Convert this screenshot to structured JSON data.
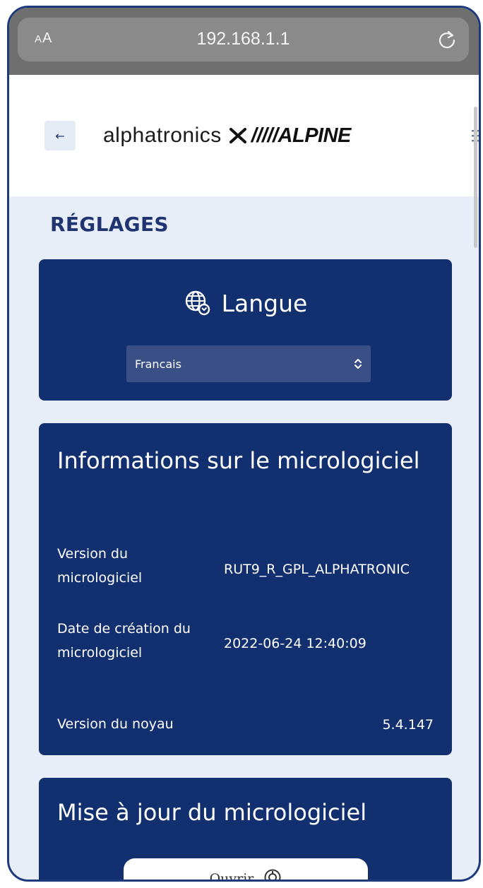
{
  "browser": {
    "text_size_label_small": "A",
    "text_size_label_large": "A",
    "url": "192.168.1.1"
  },
  "header": {
    "back_label": "←",
    "logo_brand_left": "alphatronics",
    "logo_separator": "×",
    "logo_brand_right": "/////ALPINE"
  },
  "page": {
    "title": "RÉGLAGES"
  },
  "language_card": {
    "title": "Langue",
    "selected_language": "Francais"
  },
  "firmware_info": {
    "title": "Informations sur le micrologiciel",
    "rows": [
      {
        "label": "Version du micrologiciel",
        "value": "RUT9_R_GPL_ALPHATRONIC"
      },
      {
        "label": "Date de création du micrologiciel",
        "value": "2022-06-24 12:40:09"
      },
      {
        "label": "Version du noyau",
        "value": "5.4.147"
      }
    ]
  },
  "firmware_update": {
    "title": "Mise à jour du micrologiciel",
    "open_button_label": "Ouvrir"
  },
  "colors": {
    "card_background": "#12306f",
    "title_blue": "#1f3470",
    "page_background": "#e8eef7",
    "browser_bar": "#6f6f6f"
  },
  "icons": [
    "reload-icon",
    "back-arrow-icon",
    "menu-icon",
    "globe-icon",
    "select-arrows-icon",
    "upload-icon"
  ]
}
